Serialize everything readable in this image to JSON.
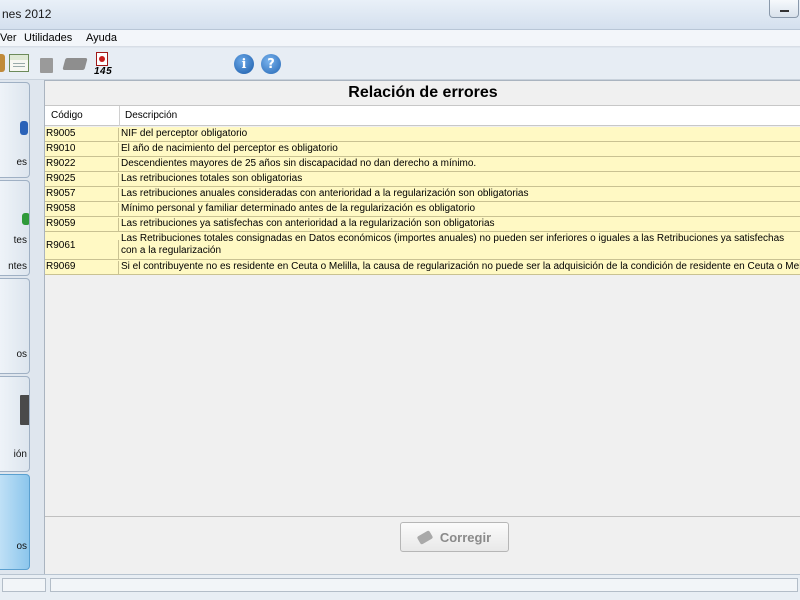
{
  "window": {
    "title": "nes 2012"
  },
  "menu": {
    "items": [
      "Ver",
      "Utilidades",
      "Ayuda"
    ]
  },
  "toolbar": {
    "form_number": "145",
    "info_glyph": "i",
    "help_glyph": "?"
  },
  "sidebar": {
    "items": [
      "es",
      "tes",
      "ntes",
      "os",
      "ión",
      "os"
    ]
  },
  "panel": {
    "title": "Relación de errores",
    "columns": {
      "code": "Código",
      "description": "Descripción"
    },
    "rows": [
      {
        "code": "R9005",
        "description": "NIF del perceptor obligatorio"
      },
      {
        "code": "R9010",
        "description": "El año de nacimiento del perceptor es obligatorio"
      },
      {
        "code": "R9022",
        "description": "Descendientes mayores de 25 años sin discapacidad no dan derecho a mínimo."
      },
      {
        "code": "R9025",
        "description": "Las retribuciones totales son obligatorias"
      },
      {
        "code": "R9057",
        "description": "Las retribuciones anuales consideradas con anterioridad a la regularización son obligatorias"
      },
      {
        "code": "R9058",
        "description": "Mínimo personal y familiar determinado antes de la regularización es obligatorio"
      },
      {
        "code": "R9059",
        "description": "Las retribuciones ya satisfechas con anterioridad a la regularización son obligatorias"
      },
      {
        "code": "R9061",
        "description": "Las Retribuciones totales consignadas en Datos económicos (importes anuales) no pueden ser inferiores o iguales a las Retribuciones ya satisfechas con a la regularización"
      },
      {
        "code": "R9069",
        "description": "Si el contribuyente no es residente en Ceuta o Melilla, la causa de regularización no puede ser la adquisición de la condición de residente en Ceuta o Melill"
      }
    ],
    "corregir_label": "Corregir"
  },
  "colors": {
    "row_background": "#fff9c4",
    "active_tab": "#8cc6ec"
  }
}
